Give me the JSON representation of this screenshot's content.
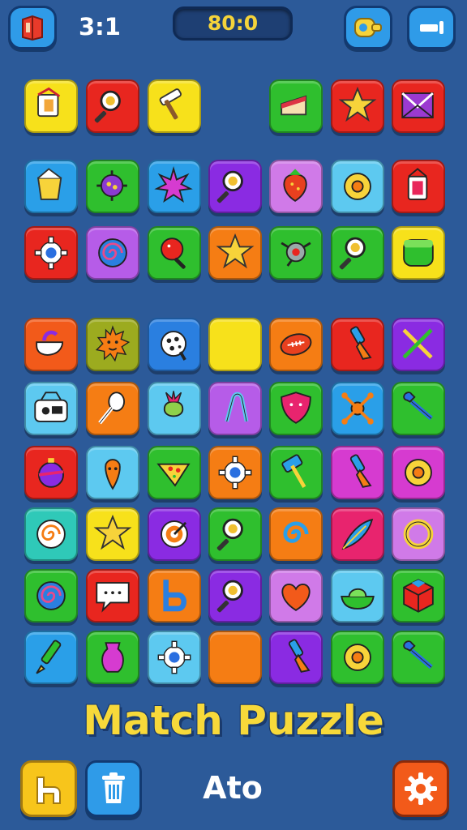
{
  "header": {
    "score": "3:1",
    "timer": "80:0"
  },
  "title": "Match Puzzle",
  "footer": {
    "mode_label": "Ato"
  },
  "colors": {
    "background": "#2c5a99",
    "title": "#f7d93a",
    "timer_text": "#f5d33a"
  },
  "tiles": [
    {
      "row": 0,
      "col": 0,
      "color": "#f7e11b",
      "icon": "paint-bucket-icon"
    },
    {
      "row": 0,
      "col": 1,
      "color": "#e8261f",
      "icon": "magnifier-icon"
    },
    {
      "row": 0,
      "col": 2,
      "color": "#f7e11b",
      "icon": "hammer-icon"
    },
    {
      "row": 0,
      "col": 4,
      "color": "#2fbf2e",
      "icon": "cake-slice-icon"
    },
    {
      "row": 0,
      "col": 5,
      "color": "#e8261f",
      "icon": "star-icon"
    },
    {
      "row": 0,
      "col": 6,
      "color": "#e8261f",
      "icon": "envelope-icon"
    },
    {
      "row": 1,
      "col": 0,
      "color": "#2a9fe8",
      "icon": "bucket-icon"
    },
    {
      "row": 1,
      "col": 1,
      "color": "#2fbf2e",
      "icon": "virus-icon"
    },
    {
      "row": 1,
      "col": 2,
      "color": "#2a9fe8",
      "icon": "spiky-ball-icon"
    },
    {
      "row": 1,
      "col": 3,
      "color": "#8a2be2",
      "icon": "magnifier-icon"
    },
    {
      "row": 1,
      "col": 4,
      "color": "#d07ae8",
      "icon": "strawberry-icon"
    },
    {
      "row": 1,
      "col": 5,
      "color": "#5dc9f0",
      "icon": "donut-icon"
    },
    {
      "row": 1,
      "col": 6,
      "color": "#e8261f",
      "icon": "lantern-icon"
    },
    {
      "row": 2,
      "col": 0,
      "color": "#e8261f",
      "icon": "gear-icon"
    },
    {
      "row": 2,
      "col": 1,
      "color": "#b65ce8",
      "icon": "spiral-icon"
    },
    {
      "row": 2,
      "col": 2,
      "color": "#2fbf2e",
      "icon": "lollipop-icon"
    },
    {
      "row": 2,
      "col": 3,
      "color": "#f57d14",
      "icon": "star-icon"
    },
    {
      "row": 2,
      "col": 4,
      "color": "#2fbf2e",
      "icon": "robot-icon"
    },
    {
      "row": 2,
      "col": 5,
      "color": "#2fbf2e",
      "icon": "magnifier-icon"
    },
    {
      "row": 2,
      "col": 6,
      "color": "#f7e11b",
      "icon": "jar-icon"
    },
    {
      "row": 3,
      "col": 0,
      "color": "#f25a1a",
      "icon": "teapot-icon"
    },
    {
      "row": 3,
      "col": 1,
      "color": "#9cab1f",
      "icon": "sun-face-icon"
    },
    {
      "row": 3,
      "col": 2,
      "color": "#2a7fe0",
      "icon": "cookie-icon"
    },
    {
      "row": 3,
      "col": 3,
      "color": "#f7e11b",
      "icon": "blank-icon"
    },
    {
      "row": 3,
      "col": 4,
      "color": "#f57d14",
      "icon": "football-icon"
    },
    {
      "row": 3,
      "col": 5,
      "color": "#e8261f",
      "icon": "paintbrush-icon"
    },
    {
      "row": 3,
      "col": 6,
      "color": "#8a2be2",
      "icon": "crossed-tools-icon"
    },
    {
      "row": 4,
      "col": 0,
      "color": "#5dc9f0",
      "icon": "radio-icon"
    },
    {
      "row": 4,
      "col": 1,
      "color": "#f57d14",
      "icon": "whisk-icon"
    },
    {
      "row": 4,
      "col": 2,
      "color": "#5dc9f0",
      "icon": "turnip-icon"
    },
    {
      "row": 4,
      "col": 3,
      "color": "#b65ce8",
      "icon": "pliers-icon"
    },
    {
      "row": 4,
      "col": 4,
      "color": "#2fbf2e",
      "icon": "shield-icon"
    },
    {
      "row": 4,
      "col": 5,
      "color": "#2a9fe8",
      "icon": "bones-icon"
    },
    {
      "row": 4,
      "col": 6,
      "color": "#2fbf2e",
      "icon": "wrench-icon"
    },
    {
      "row": 5,
      "col": 0,
      "color": "#e8261f",
      "icon": "ornament-icon"
    },
    {
      "row": 5,
      "col": 1,
      "color": "#5dc9f0",
      "icon": "carrot-icon"
    },
    {
      "row": 5,
      "col": 2,
      "color": "#2fbf2e",
      "icon": "pizza-slice-icon"
    },
    {
      "row": 5,
      "col": 3,
      "color": "#f57d14",
      "icon": "gear-icon"
    },
    {
      "row": 5,
      "col": 4,
      "color": "#2fbf2e",
      "icon": "axe-icon"
    },
    {
      "row": 5,
      "col": 5,
      "color": "#d63bd0",
      "icon": "paintbrush-icon"
    },
    {
      "row": 5,
      "col": 6,
      "color": "#d63bd0",
      "icon": "donut-icon"
    },
    {
      "row": 6,
      "col": 0,
      "color": "#2fc9b8",
      "icon": "swirl-candy-icon"
    },
    {
      "row": 6,
      "col": 1,
      "color": "#f7e11b",
      "icon": "star-icon"
    },
    {
      "row": 6,
      "col": 2,
      "color": "#8a2be2",
      "icon": "target-icon"
    },
    {
      "row": 6,
      "col": 3,
      "color": "#2fbf2e",
      "icon": "magnifier-icon"
    },
    {
      "row": 6,
      "col": 4,
      "color": "#f57d14",
      "icon": "snail-icon"
    },
    {
      "row": 6,
      "col": 5,
      "color": "#e8246e",
      "icon": "feather-icon"
    },
    {
      "row": 6,
      "col": 6,
      "color": "#d07ae8",
      "icon": "ring-icon"
    },
    {
      "row": 7,
      "col": 0,
      "color": "#2fbf2e",
      "icon": "spiral-icon"
    },
    {
      "row": 7,
      "col": 1,
      "color": "#e8261f",
      "icon": "speech-bubble-icon"
    },
    {
      "row": 7,
      "col": 2,
      "color": "#f57d14",
      "icon": "letter-b-icon"
    },
    {
      "row": 7,
      "col": 3,
      "color": "#8a2be2",
      "icon": "magnifier-icon"
    },
    {
      "row": 7,
      "col": 4,
      "color": "#d07ae8",
      "icon": "heart-icon"
    },
    {
      "row": 7,
      "col": 5,
      "color": "#5dc9f0",
      "icon": "bowl-icon"
    },
    {
      "row": 7,
      "col": 6,
      "color": "#2fbf2e",
      "icon": "cube-icon"
    },
    {
      "row": 8,
      "col": 0,
      "color": "#2a9fe8",
      "icon": "pen-icon"
    },
    {
      "row": 8,
      "col": 1,
      "color": "#2fbf2e",
      "icon": "vase-icon"
    },
    {
      "row": 8,
      "col": 2,
      "color": "#5dc9f0",
      "icon": "gear-icon"
    },
    {
      "row": 8,
      "col": 3,
      "color": "#f57d14",
      "icon": "blank-icon"
    },
    {
      "row": 8,
      "col": 4,
      "color": "#8a2be2",
      "icon": "paintbrush-icon"
    },
    {
      "row": 8,
      "col": 5,
      "color": "#2fbf2e",
      "icon": "donut-icon"
    },
    {
      "row": 8,
      "col": 6,
      "color": "#2fbf2e",
      "icon": "wrench-icon"
    }
  ]
}
